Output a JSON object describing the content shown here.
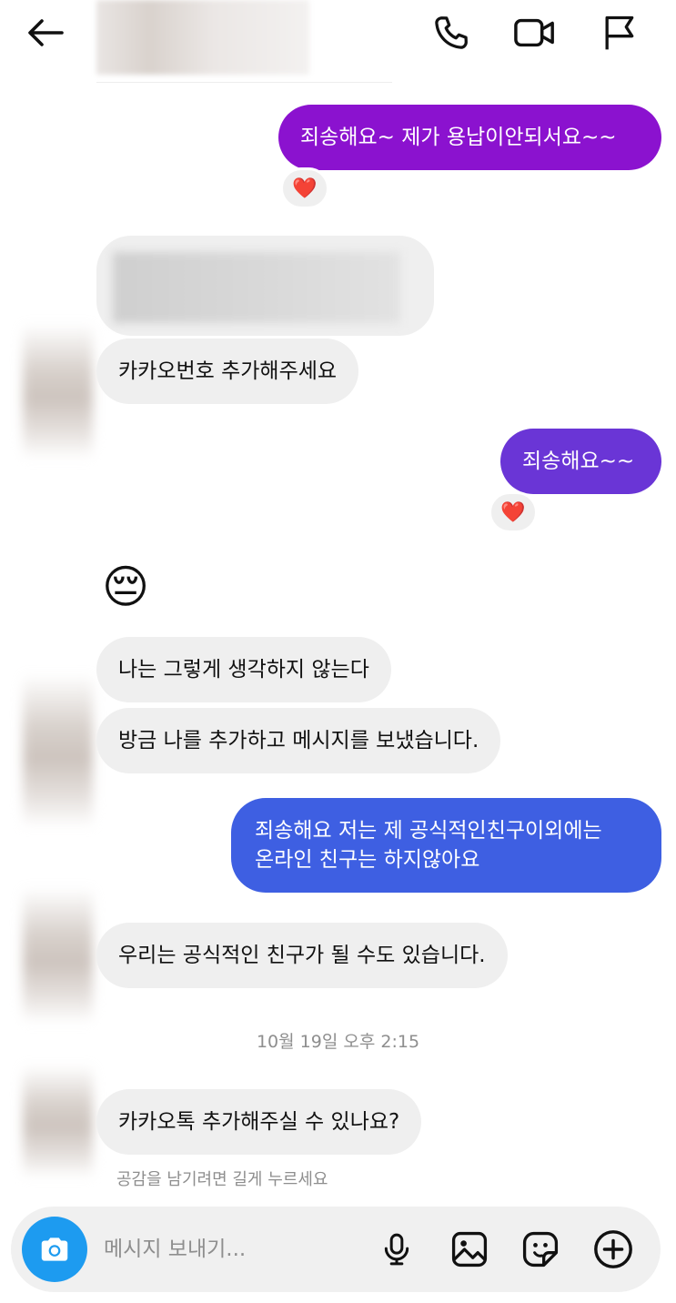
{
  "header": {
    "back_icon": "arrow-left-icon",
    "call_icon": "phone-icon",
    "video_icon": "video-camera-icon",
    "report_icon": "flag-icon"
  },
  "messages": [
    {
      "side": "out",
      "text": "죄송해요~ 제가 용납이안되서요~~",
      "reaction": "❤️"
    },
    {
      "side": "in",
      "text": "카카오번호 추가해주세요"
    },
    {
      "side": "out",
      "text": "죄송해요~~",
      "reaction": "❤️"
    },
    {
      "side": "in",
      "text": "😔"
    },
    {
      "side": "in",
      "text": "나는 그렇게 생각하지 않는다"
    },
    {
      "side": "in",
      "text": "방금 나를 추가하고 메시지를 보냈습니다."
    },
    {
      "side": "out",
      "lines": [
        "죄송해요 저는 제 공식적인친구이외에는",
        "온라인 친구는 하지않아요"
      ]
    },
    {
      "side": "in",
      "text": "우리는 공식적인 친구가 될 수도 있습니다."
    },
    {
      "side": "in",
      "text": "카카오톡 추가해주실 수 있나요?"
    }
  ],
  "timestamp": "10월 19일 오후 2:15",
  "hint": "공감을 남기려면 길게 누르세요",
  "composer": {
    "placeholder": "메시지 보내기...",
    "icons": [
      "camera-icon",
      "microphone-icon",
      "image-icon",
      "sticker-icon",
      "plus-icon"
    ]
  },
  "colors": {
    "outgoing_purple": "#8b12cf",
    "outgoing_violet": "#6a35d6",
    "outgoing_blue": "#3e5fe2",
    "incoming": "#efefef",
    "camera_button": "#1d9bf0"
  }
}
